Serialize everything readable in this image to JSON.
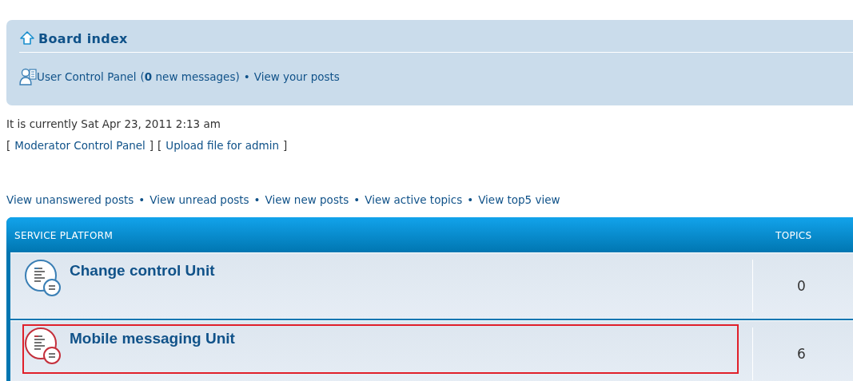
{
  "navbar": {
    "board_index": "Board index",
    "ucp_link": "User Control Panel",
    "ucp_counter": "(**0** new messages)",
    "separator": "•",
    "your_posts": "View your posts"
  },
  "info": {
    "current_time": "It is currently Sat Apr 23, 2011 2:13 am",
    "tools": [
      {
        "open": "[",
        "label": "Moderator Control Panel",
        "close": "]"
      },
      {
        "open": "[",
        "label": "Upload file for admin",
        "close": "]"
      }
    ]
  },
  "search_links": {
    "separator": "•",
    "links": [
      "View unanswered posts",
      "View unread posts",
      "View new posts",
      "View active topics",
      "View top5 view"
    ]
  },
  "forum_table": {
    "header": "SERVICE PLATFORM",
    "columns": [
      "TOPICS"
    ],
    "rows": [
      {
        "title": "Change control Unit",
        "topics": "0",
        "unread": false,
        "highlighted": false
      },
      {
        "title": "Mobile messaging Unit",
        "topics": "6",
        "unread": true,
        "highlighted": true
      }
    ]
  }
}
